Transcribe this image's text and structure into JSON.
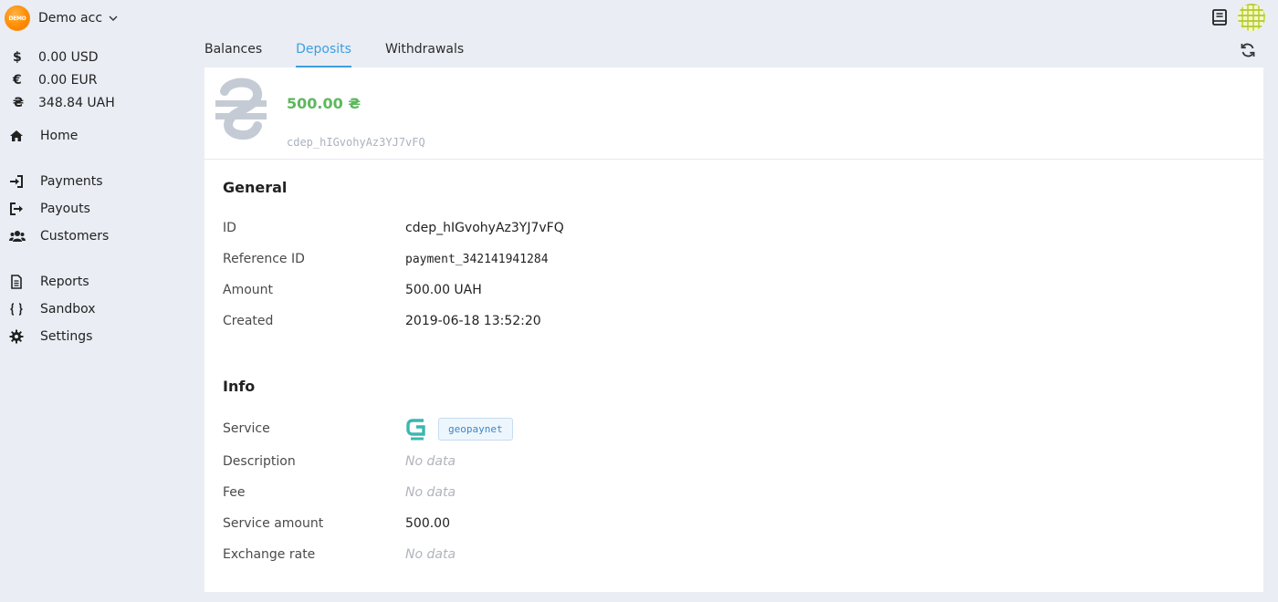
{
  "account": {
    "name": "Demo acc",
    "logo_text": "DEMO"
  },
  "balances": [
    {
      "symbol": "$",
      "amount": "0.00 USD"
    },
    {
      "symbol": "€",
      "amount": "0.00 EUR"
    },
    {
      "symbol": "₴",
      "amount": "348.84 UAH"
    }
  ],
  "nav": {
    "home": "Home",
    "payments": "Payments",
    "payouts": "Payouts",
    "customers": "Customers",
    "reports": "Reports",
    "sandbox": "Sandbox",
    "settings": "Settings"
  },
  "tabs": {
    "balances": "Balances",
    "deposits": "Deposits",
    "withdrawals": "Withdrawals"
  },
  "deposit": {
    "amount_display": "500.00 ₴",
    "id_display": "cdep_hIGvohyAz3YJ7vFQ"
  },
  "general": {
    "title": "General",
    "rows": [
      {
        "label": "ID",
        "value": "cdep_hIGvohyAz3YJ7vFQ"
      },
      {
        "label": "Reference ID",
        "value": "payment_342141941284"
      },
      {
        "label": "Amount",
        "value": "500.00 UAH"
      },
      {
        "label": "Created",
        "value": "2019-06-18 13:52:20"
      }
    ]
  },
  "info": {
    "title": "Info",
    "service_label": "Service",
    "service_name": "geopaynet",
    "rows": [
      {
        "label": "Description",
        "value": "No data"
      },
      {
        "label": "Fee",
        "value": "No data"
      },
      {
        "label": "Service amount",
        "value": "500.00"
      },
      {
        "label": "Exchange rate",
        "value": "No data"
      }
    ]
  },
  "colors": {
    "accent": "#3d9fe0",
    "amount_green": "#5cb85c",
    "background": "#eaedf4"
  },
  "icons": [
    "chevron-down-icon",
    "dollar-icon",
    "euro-icon",
    "hryvnia-icon",
    "home-icon",
    "sign-in-icon",
    "sign-out-icon",
    "users-icon",
    "file-icon",
    "braces-icon",
    "gear-icon",
    "book-icon",
    "refresh-icon",
    "geopaynet-logo-icon"
  ]
}
